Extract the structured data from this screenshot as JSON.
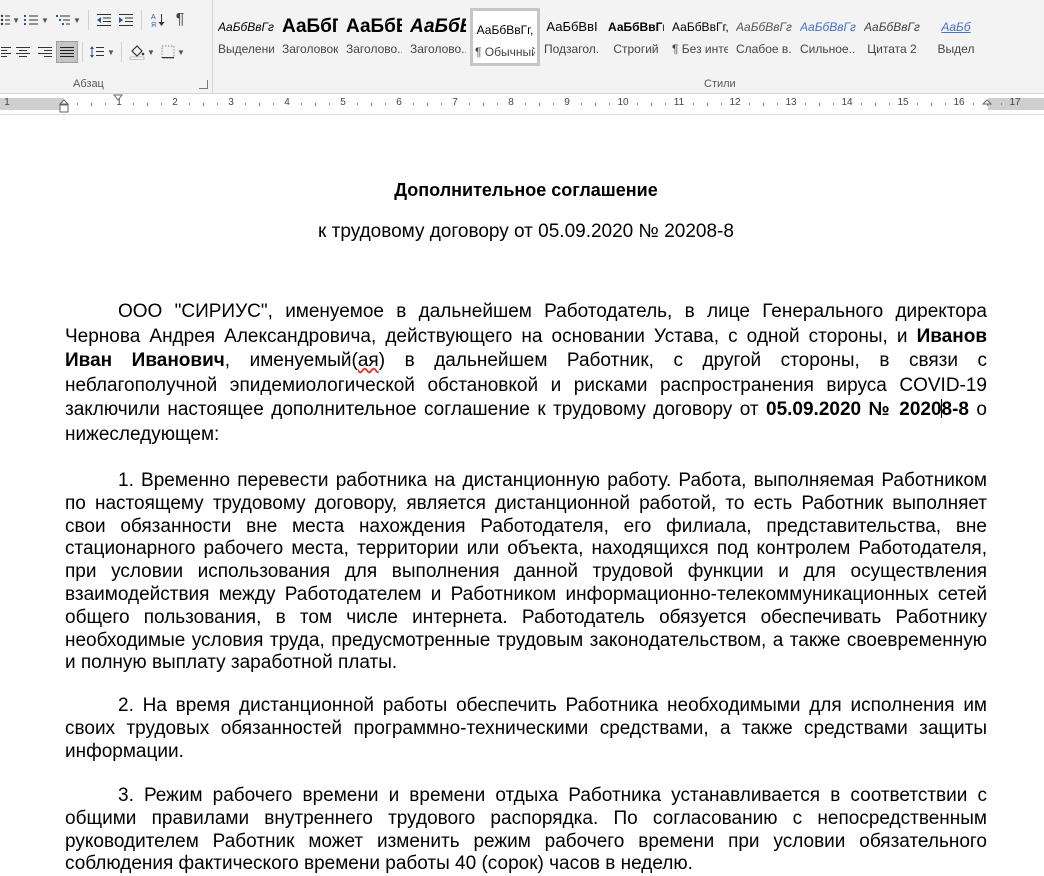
{
  "ribbon": {
    "paragraph_group": {
      "label": "Абзац"
    },
    "styles_group": {
      "label": "Стили",
      "items": [
        {
          "preview": "АаБбВвГг",
          "name": "Выделение"
        },
        {
          "preview": "АаБбГ",
          "name": "Заголовок"
        },
        {
          "preview": "АаБбЕ",
          "name": "Заголово..."
        },
        {
          "preview": "АаБбВ",
          "name": "Заголово..."
        },
        {
          "preview": "АаБбВвГг,",
          "name": "¶ Обычный"
        },
        {
          "preview": "АаБбВвІ",
          "name": "Подзагол..."
        },
        {
          "preview": "АаБбВвГг,",
          "name": "Строгий"
        },
        {
          "preview": "АаБбВвГг,",
          "name": "¶ Без инте..."
        },
        {
          "preview": "АаБбВвГг",
          "name": "Слабое в..."
        },
        {
          "preview": "АаБбВвГг",
          "name": "Сильное..."
        },
        {
          "preview": "АаБбВвГг",
          "name": "Цитата 2"
        },
        {
          "preview": "АаБб",
          "name": "Выдел"
        }
      ]
    }
  },
  "ruler": {
    "numbers": [
      "1",
      "1",
      "2",
      "3",
      "4",
      "5",
      "6",
      "7",
      "8",
      "9",
      "10",
      "11",
      "12",
      "13",
      "14",
      "15",
      "16",
      "17"
    ]
  },
  "document": {
    "title": "Дополнительное соглашение",
    "subtitle": "к трудовому договору от 05.09.2020 № 20208-8",
    "intro": {
      "t1": "ООО \"СИРИУС\", именуемое в дальнейшем Работодатель, в лице Генерального директора Чернова Андрея Александровича, действующего на основании Устава, с одной стороны, и ",
      "employee_name": "Иванов Иван Иванович",
      "t2": ", именуемый(",
      "suffix": "ая",
      "t3": ") в дальнейшем Работник, с другой стороны, в связи с неблагополучной эпидемиологической обстановкой и рисками распространения вируса COVID-19 заключили настоящее дополнительное соглашение к трудовому договору от ",
      "contract_ref_a": "05.09.2020 № 2020",
      "contract_ref_b": "8-8",
      "t4": " о нижеследующем:"
    },
    "clause1": "1. Временно перевести работника на дистанционную работу. Работа, выполняемая Работником по настоящему трудовому договору, является дистанционной работой, то есть Работник выполняет свои обязанности вне места нахождения Работодателя, его филиала, представительства, вне стационарного рабочего места, территории или объекта, находящихся под контролем Работодателя, при условии использования для выполнения данной трудовой функции и для осуществления взаимодействия между Работодателем и Работником информационно-телекоммуникационных сетей общего пользования, в том числе интернета. Работодатель обязуется обеспечивать Работнику необходимые условия труда, предусмотренные трудовым законодательством, а также своевременную и полную выплату заработной платы.",
    "clause2": "2. На время дистанционной работы обеспечить Работника необходимыми для исполнения им своих трудовых обязанностей программно-техническими средствами, а также средствами защиты информации.",
    "clause3": "3. Режим рабочего времени и времени отдыха Работника устанавливается в соответствии с общими правилами внутреннего трудового распорядка. По согласованию с непосредственным руководителем Работник может изменить режим рабочего времени при условии обязательного соблюдения фактического времени работы 40 (сорок) часов в неделю."
  }
}
